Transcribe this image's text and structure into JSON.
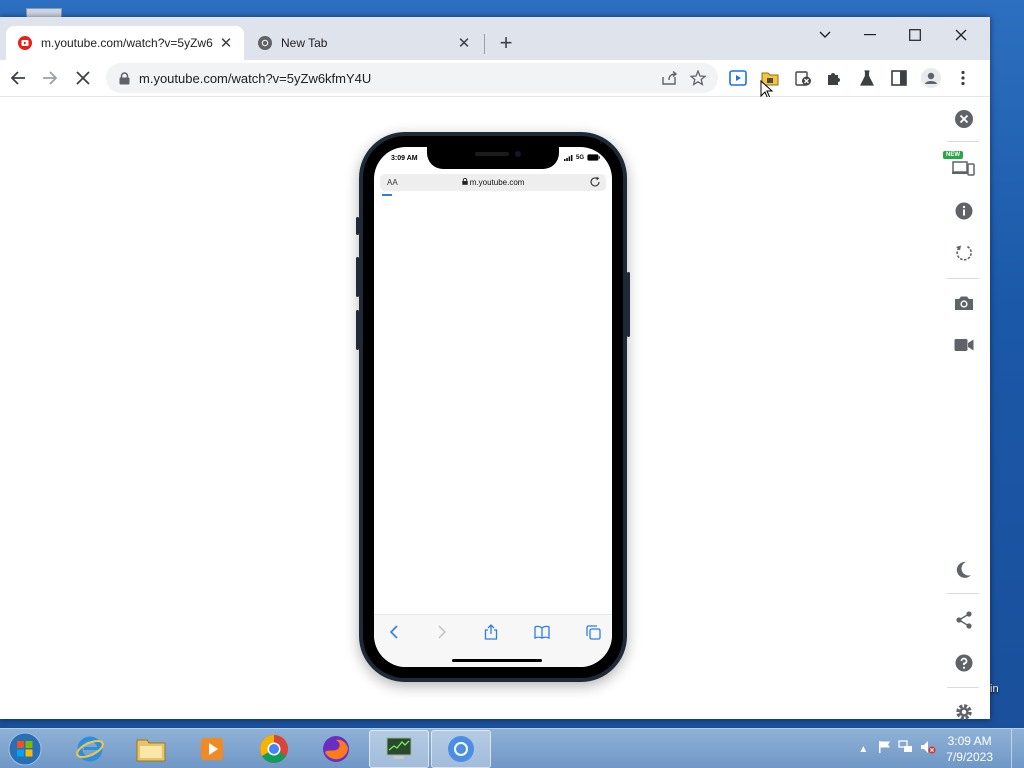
{
  "desktop": {
    "partial_label": "in"
  },
  "browser": {
    "tabs": [
      {
        "title": "m.youtube.com/watch?v=5yZw6",
        "active": true,
        "icon": "youtube-icon"
      },
      {
        "title": "New Tab",
        "active": false,
        "icon": "chrome-icon"
      }
    ],
    "url": "m.youtube.com/watch?v=5yZw6kfmY4U",
    "loading": true
  },
  "phone": {
    "time": "3:09 AM",
    "network": "5G",
    "aa_label": "AA",
    "address": "m.youtube.com"
  },
  "side_panel": {
    "new_badge": "NEW",
    "icons": [
      "close-icon",
      "devices-icon",
      "info-icon",
      "rotate-icon",
      "camera-icon",
      "video-icon",
      "dark-mode-icon",
      "share-icon",
      "help-icon",
      "settings-icon"
    ]
  },
  "taskbar": {
    "time": "3:09 AM",
    "date": "7/9/2023",
    "apps": [
      "internet-explorer",
      "file-explorer",
      "media-player",
      "chrome",
      "firefox",
      "task-manager",
      "chromium"
    ]
  }
}
